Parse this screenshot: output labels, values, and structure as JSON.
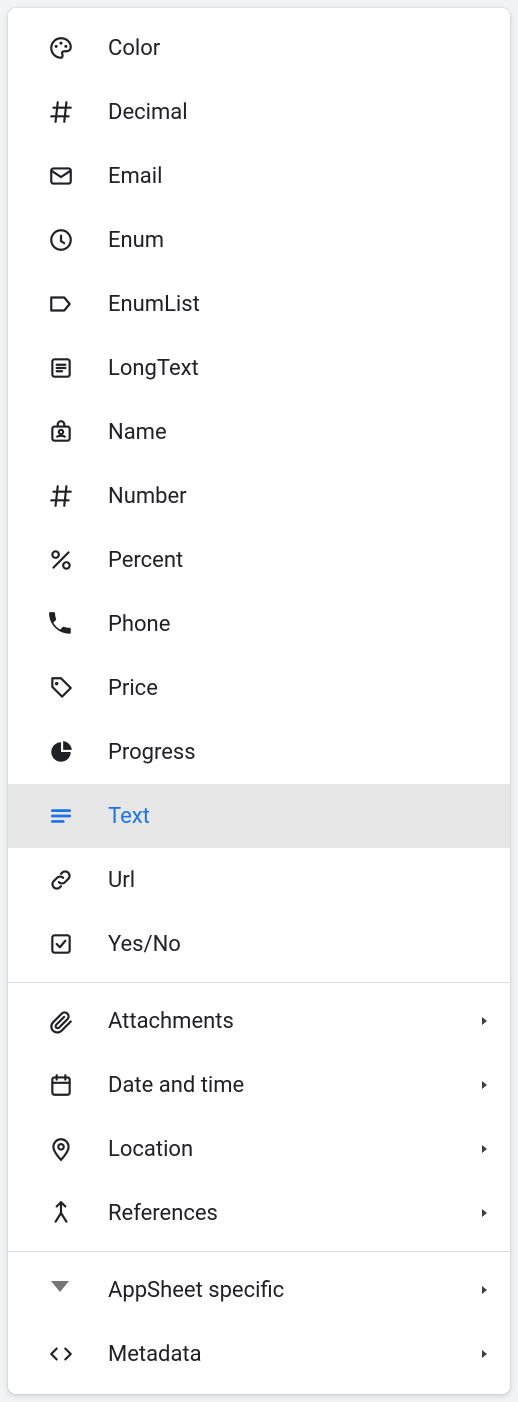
{
  "colors": {
    "accent": "#1a73e8"
  },
  "groups": [
    {
      "items": [
        {
          "icon": "palette-icon",
          "label": "Color",
          "selected": false,
          "submenu": false
        },
        {
          "icon": "hash-icon",
          "label": "Decimal",
          "selected": false,
          "submenu": false
        },
        {
          "icon": "mail-icon",
          "label": "Email",
          "selected": false,
          "submenu": false
        },
        {
          "icon": "clock-icon",
          "label": "Enum",
          "selected": false,
          "submenu": false
        },
        {
          "icon": "tag-outline-icon",
          "label": "EnumList",
          "selected": false,
          "submenu": false
        },
        {
          "icon": "notes-box-icon",
          "label": "LongText",
          "selected": false,
          "submenu": false
        },
        {
          "icon": "badge-icon",
          "label": "Name",
          "selected": false,
          "submenu": false
        },
        {
          "icon": "hash-icon",
          "label": "Number",
          "selected": false,
          "submenu": false
        },
        {
          "icon": "percent-icon",
          "label": "Percent",
          "selected": false,
          "submenu": false
        },
        {
          "icon": "phone-icon",
          "label": "Phone",
          "selected": false,
          "submenu": false
        },
        {
          "icon": "price-tag-icon",
          "label": "Price",
          "selected": false,
          "submenu": false
        },
        {
          "icon": "pie-icon",
          "label": "Progress",
          "selected": false,
          "submenu": false
        },
        {
          "icon": "text-icon",
          "label": "Text",
          "selected": true,
          "submenu": false
        },
        {
          "icon": "link-icon",
          "label": "Url",
          "selected": false,
          "submenu": false
        },
        {
          "icon": "checkbox-icon",
          "label": "Yes/No",
          "selected": false,
          "submenu": false
        }
      ]
    },
    {
      "items": [
        {
          "icon": "attachment-icon",
          "label": "Attachments",
          "selected": false,
          "submenu": true
        },
        {
          "icon": "calendar-icon",
          "label": "Date and time",
          "selected": false,
          "submenu": true
        },
        {
          "icon": "location-icon",
          "label": "Location",
          "selected": false,
          "submenu": true
        },
        {
          "icon": "merge-icon",
          "label": "References",
          "selected": false,
          "submenu": true
        }
      ]
    },
    {
      "items": [
        {
          "icon": "appsheet-icon",
          "label": "AppSheet specific",
          "selected": false,
          "submenu": true
        },
        {
          "icon": "code-icon",
          "label": "Metadata",
          "selected": false,
          "submenu": true
        }
      ]
    }
  ]
}
